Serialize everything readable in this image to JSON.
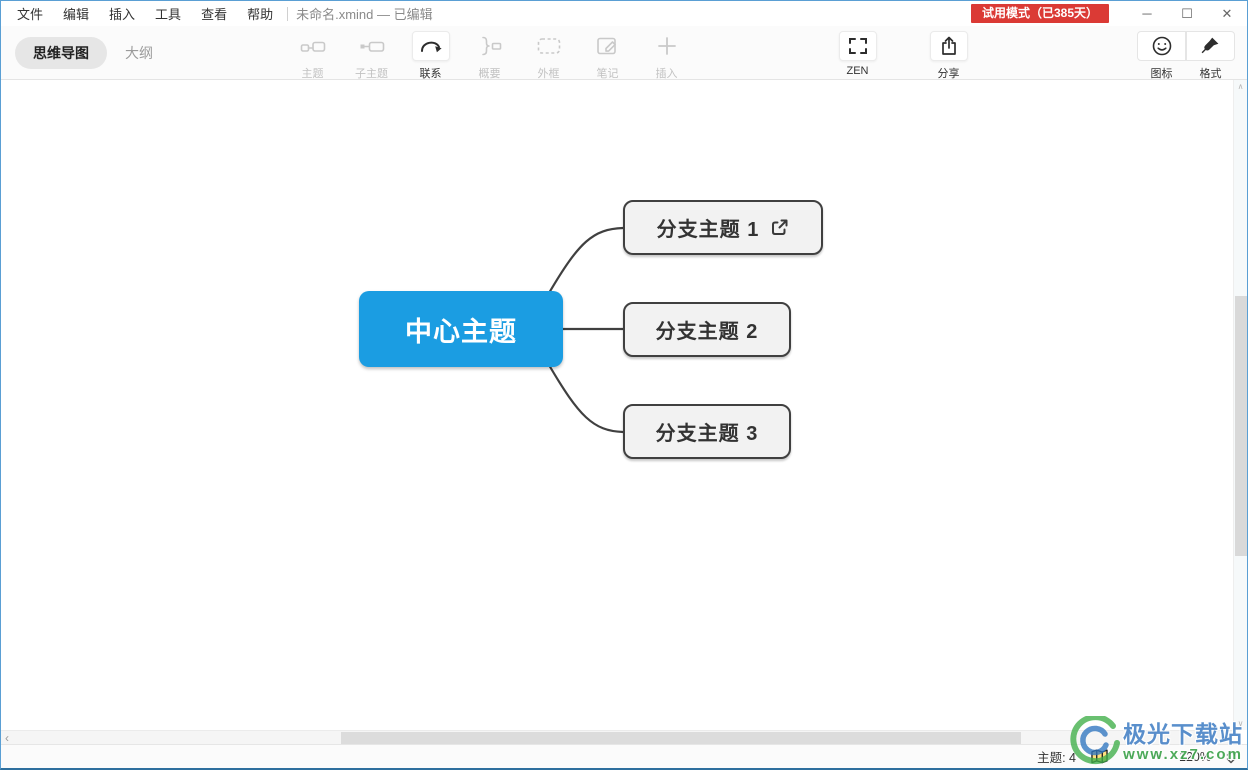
{
  "titlebar": {
    "menus": [
      "文件",
      "编辑",
      "插入",
      "工具",
      "查看",
      "帮助"
    ],
    "filename": "未命名.xmind — 已编辑",
    "trial_badge": "试用模式（已385天）",
    "window_controls": {
      "minimize": "─",
      "maximize": "☐",
      "close": "✕"
    }
  },
  "toolbar": {
    "view_tabs": [
      {
        "label": "思维导图",
        "active": true
      },
      {
        "label": "大纲",
        "active": false
      }
    ],
    "tools": [
      {
        "name": "topic",
        "label": "主题",
        "enabled": false
      },
      {
        "name": "subtopic",
        "label": "子主题",
        "enabled": false
      },
      {
        "name": "relationship",
        "label": "联系",
        "enabled": true
      },
      {
        "name": "summary",
        "label": "概要",
        "enabled": false
      },
      {
        "name": "boundary",
        "label": "外框",
        "enabled": false
      },
      {
        "name": "notes",
        "label": "笔记",
        "enabled": false
      },
      {
        "name": "insert",
        "label": "插入",
        "enabled": false
      }
    ],
    "zen": {
      "label": "ZEN"
    },
    "share": {
      "label": "分享"
    },
    "icon_panel": {
      "label": "图标"
    },
    "format_panel": {
      "label": "格式"
    }
  },
  "mindmap": {
    "central_topic": {
      "text": "中心主题",
      "bg_color": "#1b9de2",
      "text_color": "#ffffff"
    },
    "branches": [
      {
        "text": "分支主题 1",
        "has_hyperlink_icon": true
      },
      {
        "text": "分支主题 2",
        "has_hyperlink_icon": false
      },
      {
        "text": "分支主题 3",
        "has_hyperlink_icon": false
      }
    ],
    "branch_style": {
      "fill": "#f2f2f2",
      "border": "#404040"
    }
  },
  "statusbar": {
    "topic_count": "主题: 4",
    "zoom_out": "−",
    "zoom_in": "+",
    "zoom_level": "120%"
  },
  "scrollbars": {
    "h_left_arrow": "‹",
    "v_up_arrow": "∧",
    "v_down_arrow": "∨"
  },
  "watermark": {
    "name": "极光下载站",
    "url": "www.xz7.com"
  },
  "colors": {
    "accent_blue": "#1b9de2",
    "badge_red": "#db3a35",
    "window_border": "#5a9fd4",
    "toolbar_bg": "#fbfbfb"
  }
}
